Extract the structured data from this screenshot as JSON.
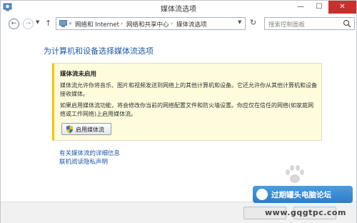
{
  "window": {
    "title": "媒体流选项"
  },
  "nav": {
    "breadcrumbs": [
      "网络和 Internet",
      "网络和共享中心",
      "媒体流选项"
    ],
    "search_placeholder": "搜索控制面板"
  },
  "content": {
    "heading": "为计算机和设备选择媒体流选项",
    "info_title": "媒体流未启用",
    "info_p1": "媒体流允许你将音乐、图片和视频发送到网络上的其他计算机和设备。它还允许你从其他计算机和设备接收媒体。",
    "info_p2": "如果启用媒体流功能，将会修改你当前的网络配置文件和防火墙设置。你应仅在信任的网络(如家庭网络或工作网络)上启用媒体流。",
    "enable_button": "启用媒体流",
    "link_details": "有关媒体流的详细信息",
    "link_privacy": "联机阅读隐私声明"
  },
  "watermark": {
    "forum_name": "过期罐头电脑论坛",
    "url": "www.gqgtpc.com"
  },
  "colors": {
    "link_blue": "#1e5aa8",
    "info_bg": "#fefcdc",
    "info_border": "#f5c400",
    "close_red": "#c7312d"
  }
}
